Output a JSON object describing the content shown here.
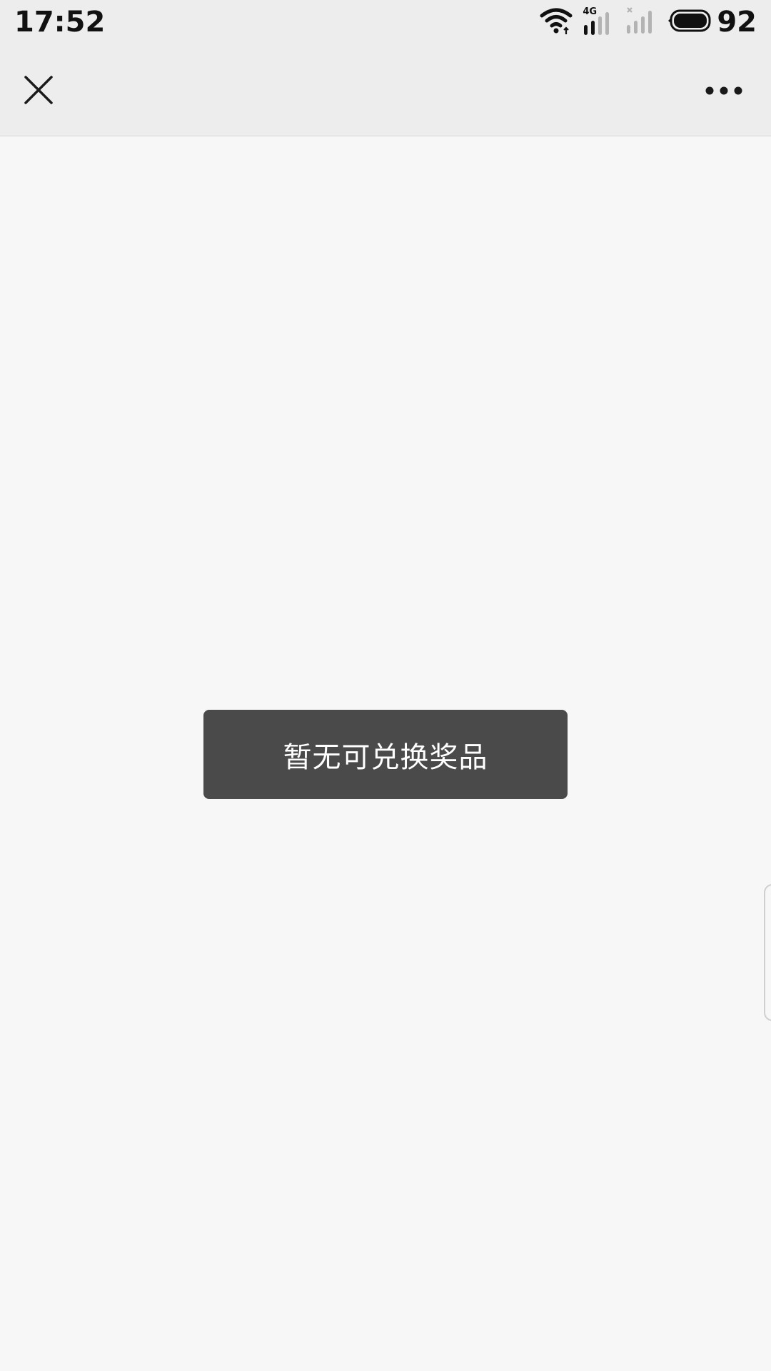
{
  "status_bar": {
    "time": "17:52",
    "battery_level": "92",
    "network_type": "4G",
    "icons": [
      "wifi-icon",
      "cellular-signal-4g-icon",
      "cellular-no-signal-icon",
      "battery-icon"
    ]
  },
  "nav_bar": {
    "close_icon": "close-icon",
    "more_icon": "more-horizontal-icon"
  },
  "toast": {
    "message": "暂无可兑换奖品"
  },
  "colors": {
    "toast_background": "#4a4a4a",
    "nav_background": "#ededed",
    "page_background": "#f7f7f7"
  }
}
